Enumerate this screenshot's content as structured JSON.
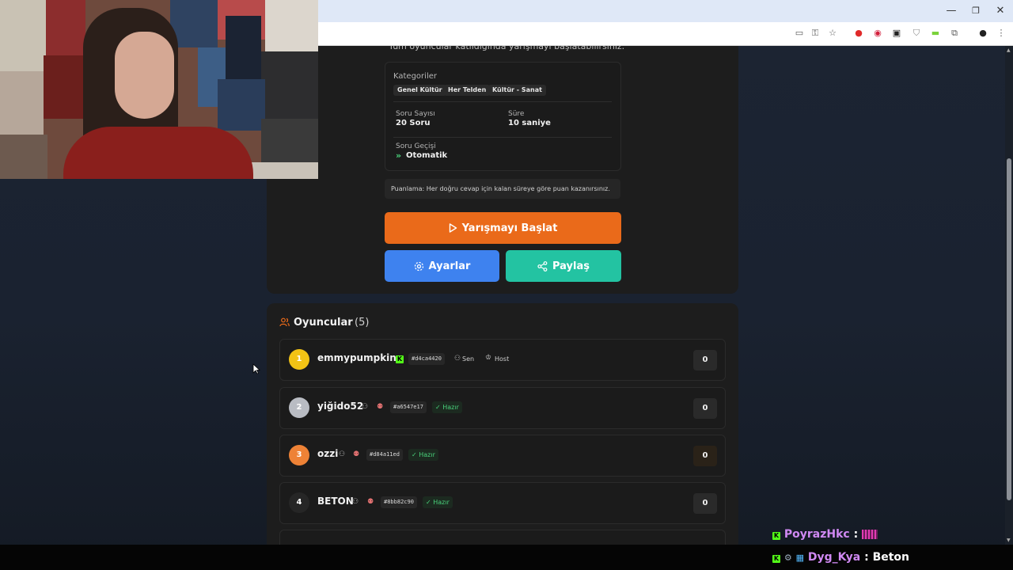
{
  "browser": {
    "minimize_glyph": "—",
    "maximize_glyph": "❐",
    "close_glyph": "✕",
    "extension_icons": [
      "cast-icon",
      "key-icon",
      "star-icon",
      "opera-icon",
      "adblock-icon",
      "extension-icon",
      "shield-icon",
      "battery-icon",
      "puzzle-icon",
      "profile-icon",
      "menu-icon"
    ]
  },
  "settings": {
    "hint": "Tüm oyuncular katıldığında yarışmayı başlatabilirsiniz.",
    "categories_label": "Kategoriler",
    "categories": [
      "Genel Kültür",
      "Her Telden",
      "Kültür - Sanat"
    ],
    "question_count_label": "Soru Sayısı",
    "question_count_value": "20 Soru",
    "duration_label": "Süre",
    "duration_value": "10 saniye",
    "transition_label": "Soru Geçişi",
    "transition_value": "Otomatik",
    "scoring_text": "Puanlama: Her doğru cevap için kalan süreye göre puan kazanırsınız.",
    "start_button": "Yarışmayı Başlat",
    "settings_button": "Ayarlar",
    "share_button": "Paylaş"
  },
  "players": {
    "title": "Oyuncular",
    "count": "(5)",
    "list": [
      {
        "rank": "1",
        "name": "emmypumpkin",
        "id": "#d4ca4420",
        "you_label": "Sen",
        "host_label": "Host",
        "score": "0"
      },
      {
        "rank": "2",
        "name": "yiğido52",
        "id": "#a6547e17",
        "status": "Hazır",
        "score": "0"
      },
      {
        "rank": "3",
        "name": "ozzi",
        "id": "#d84a11ed",
        "status": "Hazır",
        "score": "0"
      },
      {
        "rank": "4",
        "name": "BETON",
        "id": "#8bb82c90",
        "status": "Hazır",
        "score": "0"
      }
    ]
  },
  "chat": [
    {
      "user": "PoyrazHkc",
      "separator": ":",
      "message": ""
    },
    {
      "user": "Dyg_Kya",
      "separator": ":",
      "message": "Beton"
    }
  ],
  "colors": {
    "start": "#ea6a1a",
    "settings": "#3e82ef",
    "share": "#23c3a2",
    "gold": "#f2c315",
    "silver": "#b9bcc3",
    "bronze": "#ee8236",
    "kick": "#53fc18"
  }
}
